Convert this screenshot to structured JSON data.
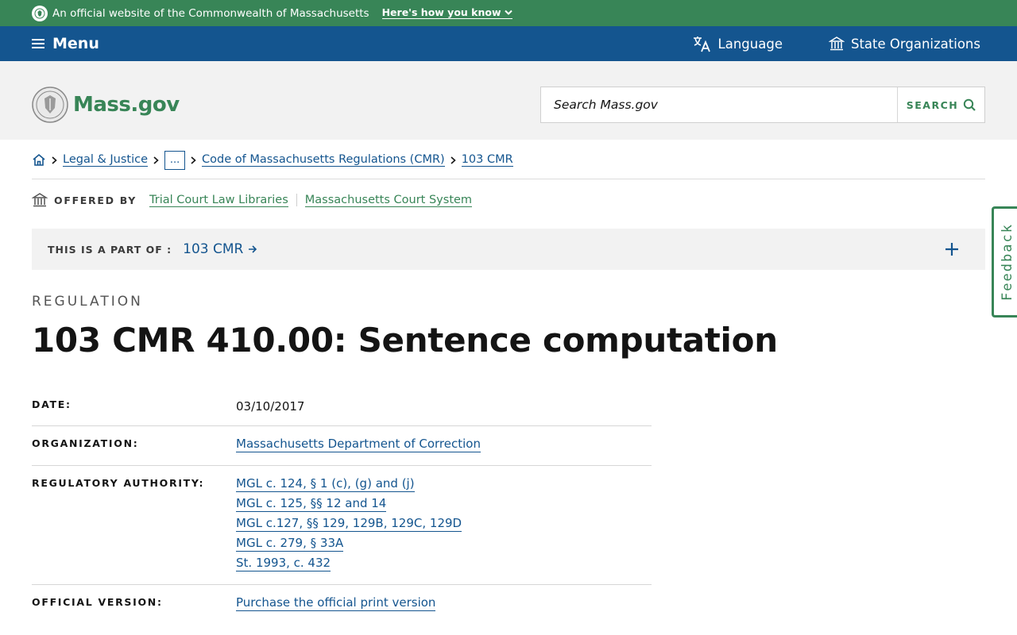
{
  "banner": {
    "text": "An official website of the Commonwealth of Massachusetts",
    "how_label": "Here's how you know"
  },
  "nav": {
    "menu_label": "Menu",
    "language_label": "Language",
    "state_orgs_label": "State Organizations"
  },
  "header": {
    "logo_text": "Mass.gov",
    "search_placeholder": "Search Mass.gov",
    "search_button": "SEARCH"
  },
  "breadcrumb": {
    "items": [
      "Legal & Justice",
      "...",
      "Code of Massachusetts Regulations (CMR)",
      "103 CMR"
    ]
  },
  "offered_by": {
    "label": "OFFERED BY",
    "orgs": [
      "Trial Court Law Libraries",
      "Massachusetts Court System"
    ]
  },
  "part_of": {
    "label": "THIS IS A PART OF :",
    "link": "103 CMR"
  },
  "feedback_label": "Feedback",
  "page": {
    "category": "REGULATION",
    "title": "103 CMR 410.00: Sentence computation"
  },
  "details": {
    "date_label": "DATE:",
    "date_value": "03/10/2017",
    "organization_label": "ORGANIZATION:",
    "organization_value": "Massachusetts Department of Correction",
    "authority_label": "REGULATORY AUTHORITY:",
    "authority_values": [
      "MGL c. 124, § 1 (c), (g) and (j)",
      "MGL c. 125, §§ 12 and 14",
      "MGL c.127, §§ 129, 129B, 129C, 129D",
      "MGL c. 279, § 33A",
      "St. 1993, c. 432"
    ],
    "official_label": "OFFICIAL VERSION:",
    "official_value": "Purchase the official print version"
  },
  "colors": {
    "banner_green": "#388557",
    "nav_blue": "#14558f",
    "header_gray": "#f2f2f2",
    "link_blue": "#14558f"
  }
}
